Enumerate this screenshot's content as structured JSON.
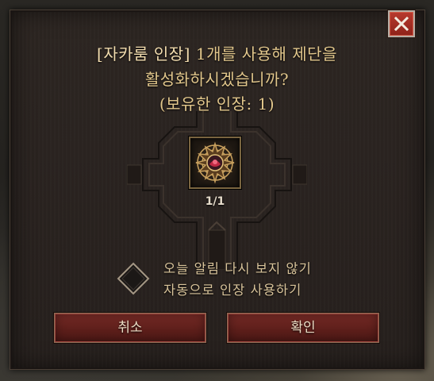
{
  "dialog": {
    "prompt_item": "[자카룸 인장]",
    "prompt_rest": " 1개를 사용해 제단을",
    "prompt_line2": "활성화하시겠습니까?",
    "prompt_line3": "(보유한 인장: 1)",
    "seal_count": "1/1",
    "option_line1": "오늘 알림 다시 보지 않기",
    "option_line2": "자동으로 인장 사용하기",
    "cancel_label": "취소",
    "confirm_label": "확인"
  },
  "icons": {
    "close": "close-icon",
    "seal": "zakarum-seal-icon",
    "checkbox": "diamond-checkbox-icon"
  },
  "colors": {
    "accent_gold": "#e2c78c",
    "button_red": "#7a2c27",
    "close_red": "#b83a2e"
  },
  "state": {
    "checkbox_checked": false
  }
}
